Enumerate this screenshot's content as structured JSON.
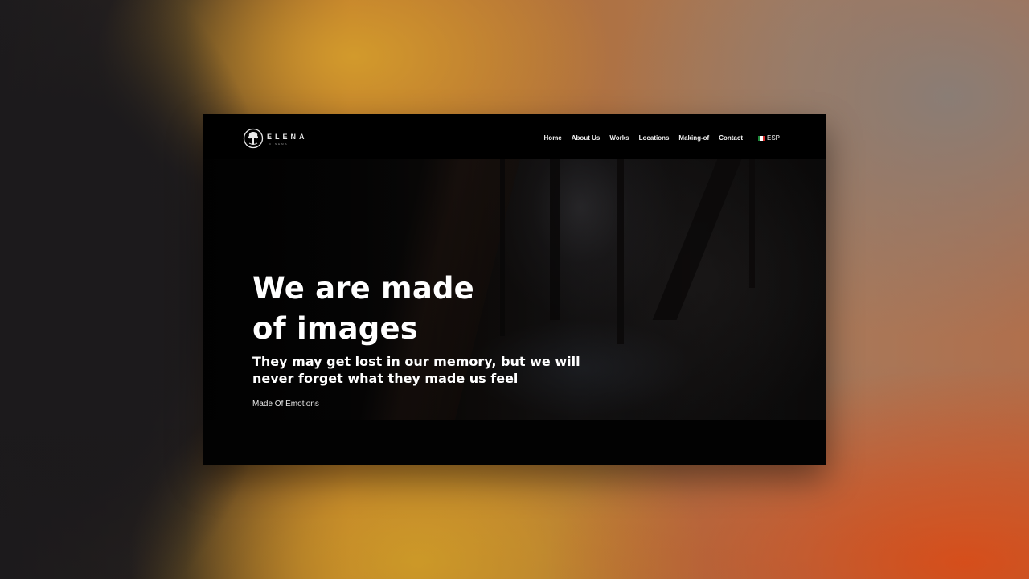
{
  "brand": {
    "name": "ELENA",
    "subtitle": "CINEMA",
    "logo_icon": "tree-circle-logo-icon"
  },
  "nav": {
    "items": [
      "Home",
      "About Us",
      "Works",
      "Locations",
      "Making-of",
      "Contact"
    ],
    "language": {
      "label": "ESP",
      "flag_icon": "mexico-flag-icon",
      "flag_colors": [
        "#1f8a3b",
        "#ffffff",
        "#d62828"
      ]
    }
  },
  "hero": {
    "headline_line1": "We are made",
    "headline_line2": "of images",
    "subheadline_line1": "They may get lost in our memory, but we will",
    "subheadline_line2": "never forget what they made us feel",
    "tagline": "Made Of Emotions"
  },
  "colors": {
    "page_background": "#050505",
    "text": "#ffffff",
    "backdrop_orange": "#e0521c",
    "backdrop_yellow": "#d6a02a"
  }
}
